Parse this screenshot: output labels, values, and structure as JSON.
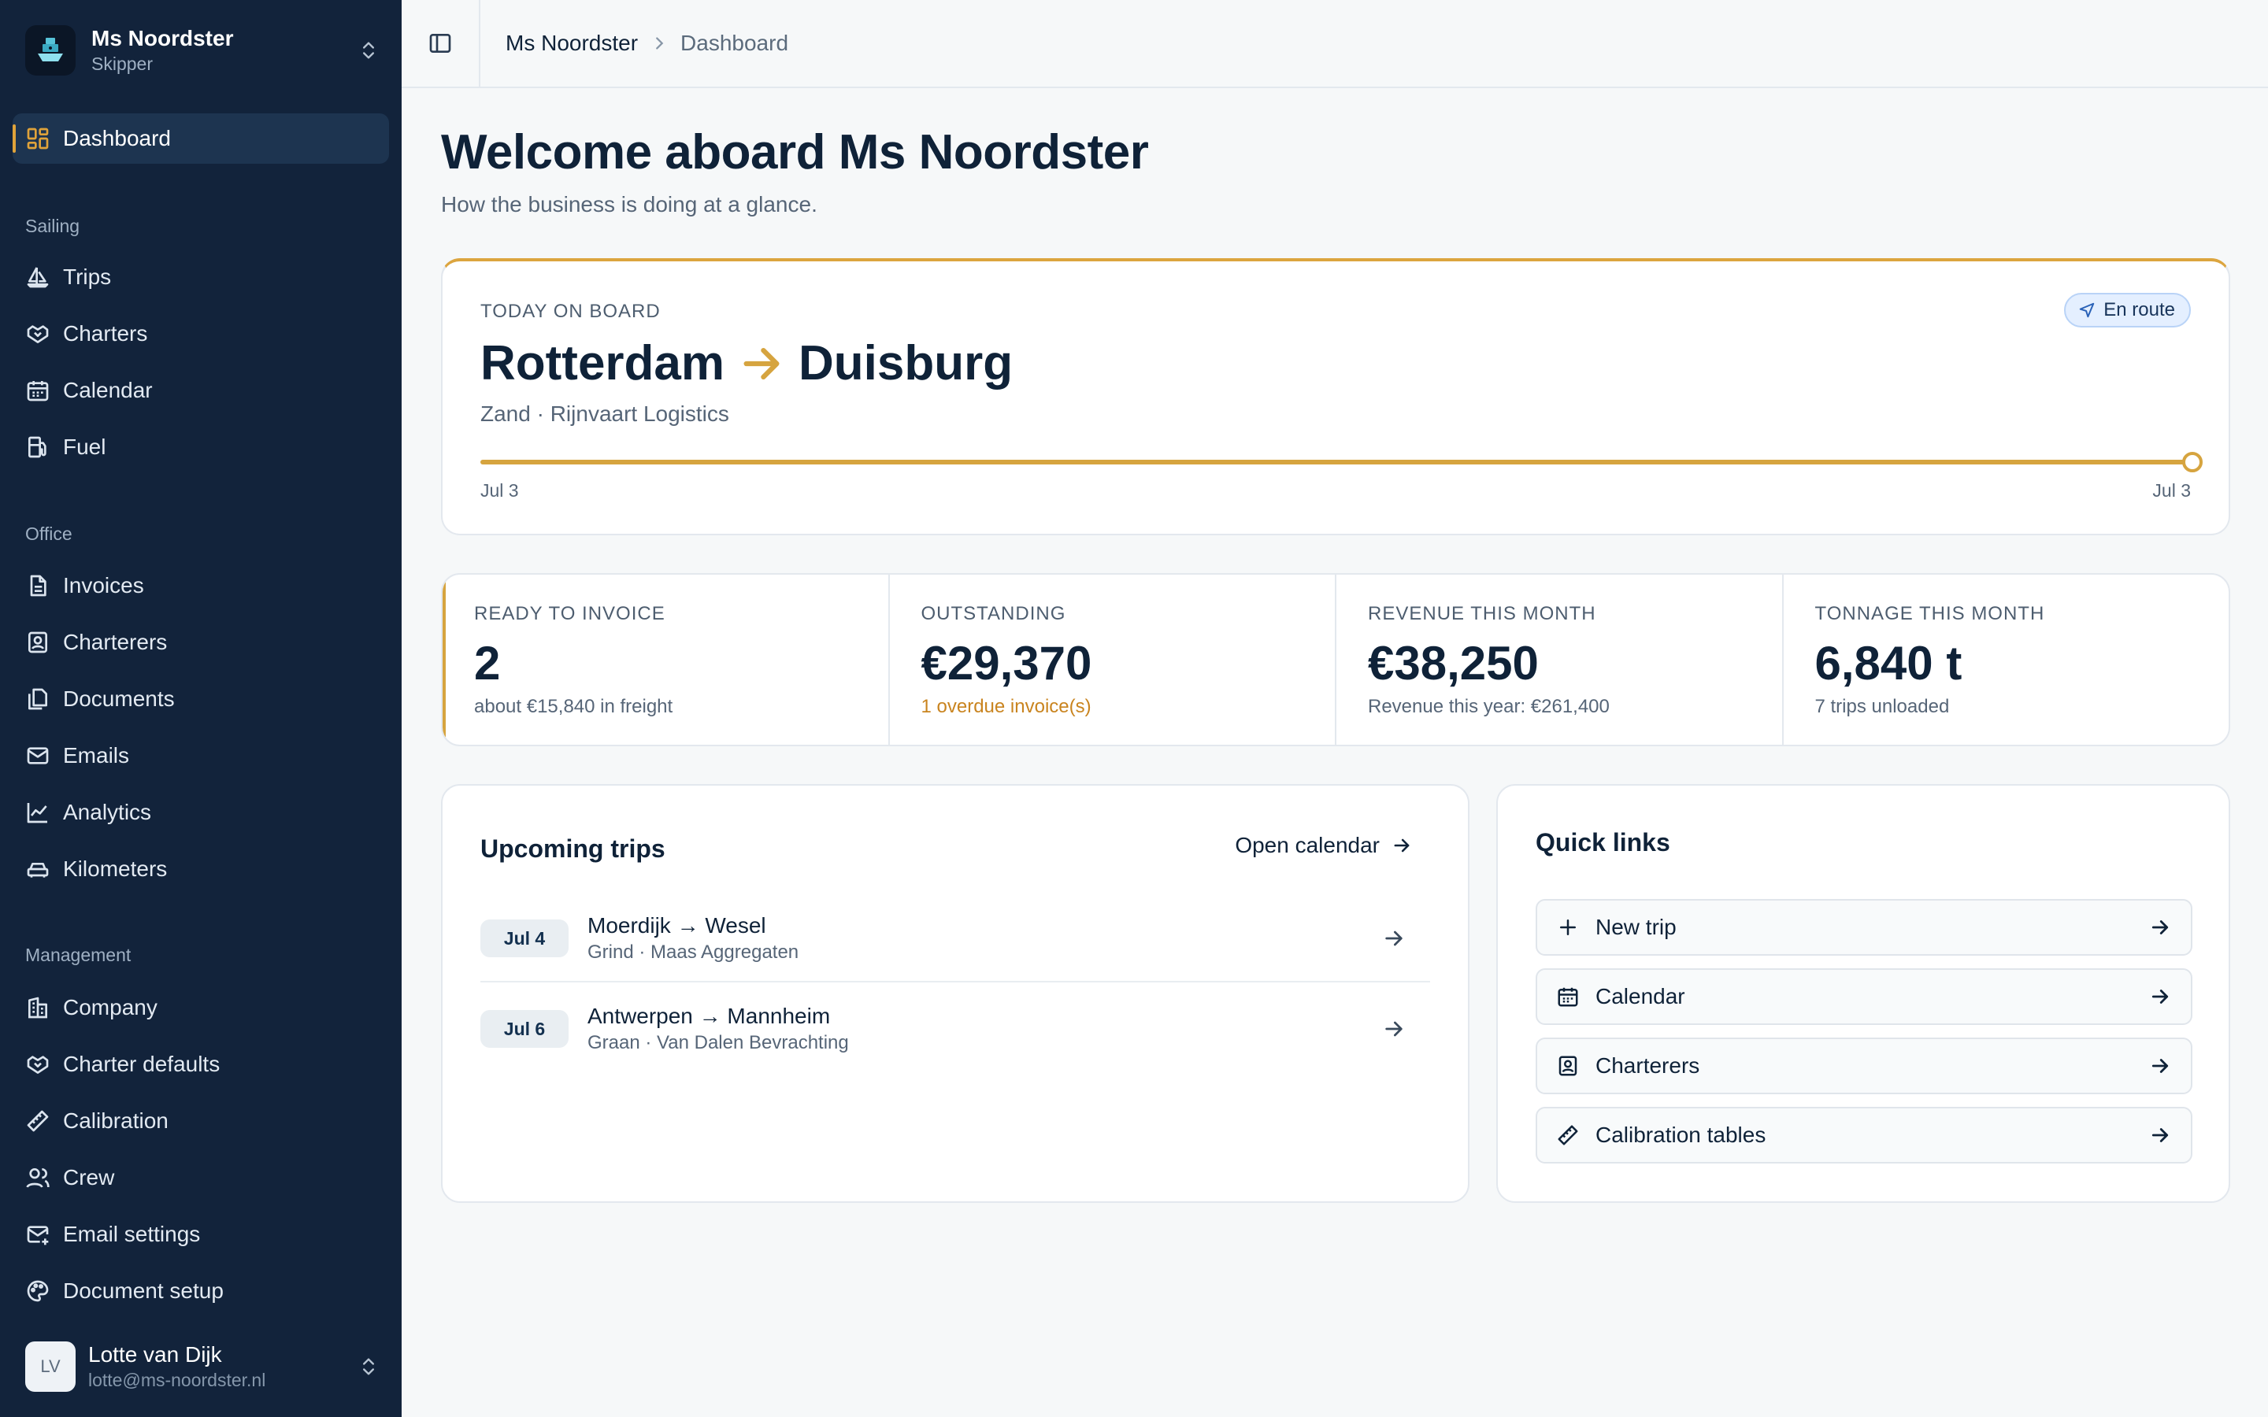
{
  "vessel": {
    "name": "Ms Noordster",
    "role": "Skipper"
  },
  "sidebar": {
    "dashboard": "Dashboard",
    "sections": {
      "sailing": "Sailing",
      "office": "Office",
      "management": "Management"
    },
    "sailing_items": [
      {
        "label": "Trips",
        "icon": "sailboat-icon"
      },
      {
        "label": "Charters",
        "icon": "handshake-icon"
      },
      {
        "label": "Calendar",
        "icon": "calendar-icon"
      },
      {
        "label": "Fuel",
        "icon": "fuel-icon"
      }
    ],
    "office_items": [
      {
        "label": "Invoices",
        "icon": "document-icon"
      },
      {
        "label": "Charterers",
        "icon": "contact-card-icon"
      },
      {
        "label": "Documents",
        "icon": "files-icon"
      },
      {
        "label": "Emails",
        "icon": "mail-icon"
      },
      {
        "label": "Analytics",
        "icon": "line-chart-icon"
      },
      {
        "label": "Kilometers",
        "icon": "car-icon"
      }
    ],
    "management_items": [
      {
        "label": "Company",
        "icon": "building-icon"
      },
      {
        "label": "Charter defaults",
        "icon": "handshake-icon"
      },
      {
        "label": "Calibration",
        "icon": "ruler-icon"
      },
      {
        "label": "Crew",
        "icon": "users-icon"
      },
      {
        "label": "Email settings",
        "icon": "mail-settings-icon"
      },
      {
        "label": "Document setup",
        "icon": "palette-icon"
      }
    ]
  },
  "user": {
    "initials": "LV",
    "name": "Lotte van Dijk",
    "email": "lotte@ms-noordster.nl"
  },
  "breadcrumb": {
    "root": "Ms Noordster",
    "current": "Dashboard"
  },
  "page": {
    "title": "Welcome aboard Ms Noordster",
    "subtitle": "How the business is doing at a glance."
  },
  "today": {
    "label": "TODAY ON BOARD",
    "from": "Rotterdam",
    "to": "Duisburg",
    "cargo": "Zand · Rijnvaart Logistics",
    "status": "En route",
    "start_date": "Jul 3",
    "end_date": "Jul 3",
    "progress": 1.0
  },
  "stats": [
    {
      "label": "READY TO INVOICE",
      "value": "2",
      "sub": "about €15,840 in freight",
      "warn": false
    },
    {
      "label": "OUTSTANDING",
      "value": "€29,370",
      "sub": "1 overdue invoice(s)",
      "warn": true
    },
    {
      "label": "REVENUE THIS MONTH",
      "value": "€38,250",
      "sub": "Revenue this year: €261,400",
      "warn": false
    },
    {
      "label": "TONNAGE THIS MONTH",
      "value": "6,840 t",
      "sub": "7 trips unloaded",
      "warn": false
    }
  ],
  "upcoming": {
    "title": "Upcoming trips",
    "open_calendar": "Open calendar",
    "trips": [
      {
        "date": "Jul 4",
        "route": "Moerdijk → Wesel",
        "cargo": "Grind · Maas Aggregaten"
      },
      {
        "date": "Jul 6",
        "route": "Antwerpen → Mannheim",
        "cargo": "Graan · Van Dalen Bevrachting"
      }
    ]
  },
  "quick_links": {
    "title": "Quick links",
    "items": [
      {
        "label": "New trip",
        "icon": "plus-icon"
      },
      {
        "label": "Calendar",
        "icon": "calendar-icon"
      },
      {
        "label": "Charterers",
        "icon": "contact-card-icon"
      },
      {
        "label": "Calibration tables",
        "icon": "ruler-icon"
      }
    ]
  },
  "colors": {
    "sidebar_bg": "#12233b",
    "accent": "#d6a43f",
    "warning": "#c9841f",
    "badge_bg": "#e4efff"
  }
}
